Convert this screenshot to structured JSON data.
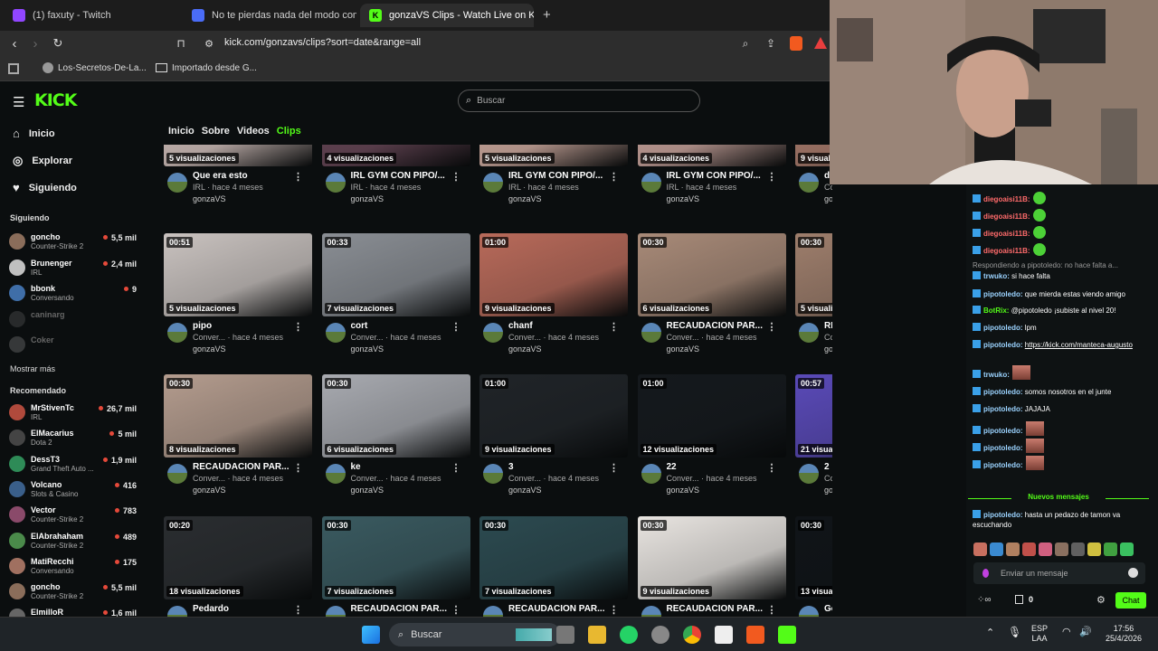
{
  "browser": {
    "tabs": [
      {
        "title": "(1) faxuty - Twitch",
        "favicon_color": "#9146ff"
      },
      {
        "title": "No te pierdas nada del modo compet",
        "favicon_color": "#4a6cf7"
      },
      {
        "title": "gonzaVS Clips - Watch Live on Ki",
        "favicon_color": "#53fc18",
        "favicon_letter": "K"
      }
    ],
    "new_tab": "+",
    "url": "kick.com/gonzavs/clips?sort=date&range=all",
    "bookmarks": [
      {
        "label": "Los-Secretos-De-La..."
      },
      {
        "label": "Importado desde G..."
      }
    ]
  },
  "kick": {
    "logo": "KICK",
    "search_placeholder": "Buscar",
    "nav": [
      {
        "label": "Inicio",
        "icon": "home-icon"
      },
      {
        "label": "Explorar",
        "icon": "compass-icon"
      },
      {
        "label": "Siguiendo",
        "icon": "heart-icon"
      }
    ],
    "following_title": "Siguiendo",
    "following": [
      {
        "name": "goncho",
        "category": "Counter-Strike 2",
        "viewers": "5,5 mil",
        "avatar": "#8a6d5a"
      },
      {
        "name": "Brunenger",
        "category": "IRL",
        "viewers": "2,4 mil",
        "avatar": "#c0c0c0"
      },
      {
        "name": "bbonk",
        "category": "Conversando",
        "viewers": "9",
        "avatar": "#3f6ea8"
      },
      {
        "name": "caninarg",
        "category": "",
        "viewers": "",
        "avatar": "#555555",
        "offline": true
      },
      {
        "name": "Coker",
        "category": "",
        "viewers": "",
        "avatar": "#777777",
        "offline": true
      }
    ],
    "show_more": "Mostrar más",
    "recommended_title": "Recomendado",
    "recommended": [
      {
        "name": "MrStivenTc",
        "category": "IRL",
        "viewers": "26,7 mil",
        "avatar": "#b04a3c"
      },
      {
        "name": "ElMacarius",
        "category": "Dota 2",
        "viewers": "5 mil",
        "avatar": "#444444"
      },
      {
        "name": "DessT3",
        "category": "Grand Theft Auto ...",
        "viewers": "1,9 mil",
        "avatar": "#2e8b57"
      },
      {
        "name": "Volcano",
        "category": "Slots & Casino",
        "viewers": "416",
        "avatar": "#3a5f8a"
      },
      {
        "name": "Vector",
        "category": "Counter-Strike 2",
        "viewers": "783",
        "avatar": "#8a4a6a"
      },
      {
        "name": "ElAbrahaham",
        "category": "Counter-Strike 2",
        "viewers": "489",
        "avatar": "#4a8a4a"
      },
      {
        "name": "MatiRecchi",
        "category": "Conversando",
        "viewers": "175",
        "avatar": "#a07060"
      },
      {
        "name": "goncho",
        "category": "Counter-Strike 2",
        "viewers": "5,5 mil",
        "avatar": "#8a6d5a"
      },
      {
        "name": "ElmilloR",
        "category": "",
        "viewers": "1,6 mil",
        "avatar": "#666666"
      }
    ],
    "channel_tabs": [
      {
        "label": "Inicio",
        "active": false
      },
      {
        "label": "Sobre",
        "active": false
      },
      {
        "label": "Videos",
        "active": false
      },
      {
        "label": "Clips",
        "active": true
      }
    ],
    "clip_rows": [
      [
        {
          "title": "Que era esto",
          "category": "IRL",
          "ago": "hace 4 meses",
          "author": "gonzaVS",
          "views": "5 visualizaciones",
          "duration": "",
          "bg": "#d8c5c0"
        },
        {
          "title": "IRL GYM CON PIPO/...",
          "category": "IRL",
          "ago": "hace 4 meses",
          "author": "gonzaVS",
          "views": "4 visualizaciones",
          "duration": "",
          "bg": "#6a4858"
        },
        {
          "title": "IRL GYM CON PIPO/...",
          "category": "IRL",
          "ago": "hace 4 meses",
          "author": "gonzaVS",
          "views": "5 visualizaciones",
          "duration": "",
          "bg": "#d6b0a4"
        },
        {
          "title": "IRL GYM CON PIPO/...",
          "category": "IRL",
          "ago": "hace 4 meses",
          "author": "gonzaVS",
          "views": "4 visualizaciones",
          "duration": "",
          "bg": "#cfa8a0"
        },
        {
          "title": "dondon",
          "category": "Conver...",
          "ago": "hace 4 meses",
          "author": "gonzaVS",
          "views": "9 visualizaciones",
          "duration": "",
          "bg": "#b08070"
        }
      ],
      [
        {
          "title": "pipo",
          "category": "Conver...",
          "ago": "hace 4 meses",
          "author": "gonzaVS",
          "views": "5 visualizaciones",
          "duration": "00:51",
          "bg": "#c9c2bf"
        },
        {
          "title": "cort",
          "category": "Conver...",
          "ago": "hace 4 meses",
          "author": "gonzaVS",
          "views": "7 visualizaciones",
          "duration": "00:33",
          "bg": "#8a8e94"
        },
        {
          "title": "chanf",
          "category": "Conver...",
          "ago": "hace 4 meses",
          "author": "gonzaVS",
          "views": "9 visualizaciones",
          "duration": "01:00",
          "bg": "#b86a5a"
        },
        {
          "title": "RECAUDACION PAR...",
          "category": "Conver...",
          "ago": "hace 4 meses",
          "author": "gonzaVS",
          "views": "6 visualizaciones",
          "duration": "00:30",
          "bg": "#a88a78"
        },
        {
          "title": "RECAUDACION PAR...",
          "category": "Conver...",
          "ago": "hace 4 meses",
          "author": "gonzaVS",
          "views": "5 visualizaciones",
          "duration": "00:30",
          "bg": "#9e7e6c"
        }
      ],
      [
        {
          "title": "RECAUDACION PAR...",
          "category": "Conver...",
          "ago": "hace 4 meses",
          "author": "gonzaVS",
          "views": "8 visualizaciones",
          "duration": "00:30",
          "bg": "#b49c8e"
        },
        {
          "title": "ke",
          "category": "Conver...",
          "ago": "hace 4 meses",
          "author": "gonzaVS",
          "views": "6 visualizaciones",
          "duration": "00:30",
          "bg": "#a8aab0"
        },
        {
          "title": "3",
          "category": "Conver...",
          "ago": "hace 4 meses",
          "author": "gonzaVS",
          "views": "9 visualizaciones",
          "duration": "01:00",
          "bg": "#202428"
        },
        {
          "title": "22",
          "category": "Conver...",
          "ago": "hace 4 meses",
          "author": "gonzaVS",
          "views": "12 visualizaciones",
          "duration": "01:00",
          "bg": "#15191d"
        },
        {
          "title": "2",
          "category": "Conver...",
          "ago": "hace 4 meses",
          "author": "gonzaVS",
          "views": "21 visualizaciones",
          "duration": "00:57",
          "bg": "#5a4ab8"
        }
      ],
      [
        {
          "title": "Pedardo",
          "category": "",
          "ago": "",
          "author": "",
          "views": "18 visualizaciones",
          "duration": "00:20",
          "bg": "#2a2d30"
        },
        {
          "title": "RECAUDACION PAR...",
          "category": "",
          "ago": "",
          "author": "",
          "views": "7 visualizaciones",
          "duration": "00:30",
          "bg": "#3a5a60"
        },
        {
          "title": "RECAUDACION PAR...",
          "category": "",
          "ago": "",
          "author": "",
          "views": "7 visualizaciones",
          "duration": "00:30",
          "bg": "#2c4a50"
        },
        {
          "title": "RECAUDACION PAR...",
          "category": "",
          "ago": "",
          "author": "",
          "views": "9 visualizaciones",
          "duration": "00:30",
          "bg": "#e8e4e0"
        },
        {
          "title": "God",
          "category": "",
          "ago": "",
          "author": "",
          "views": "13 visualizaciones",
          "duration": "00:30",
          "bg": "#101418"
        }
      ]
    ]
  },
  "chat": {
    "messages": [
      {
        "user": "diegoaisi11B:",
        "text": "",
        "emote": "green",
        "style": "red"
      },
      {
        "user": "diegoaisi11B:",
        "text": "",
        "emote": "green",
        "style": "red"
      },
      {
        "user": "diegoaisi11B:",
        "text": "",
        "emote": "green",
        "style": "red"
      },
      {
        "user": "diegoaisi11B:",
        "text": "",
        "emote": "green",
        "style": "red"
      },
      {
        "user": "",
        "text": "Respondiendo a pipotoledo: no hace falta a...",
        "emote": "",
        "style": "reply"
      },
      {
        "user": "trwuko:",
        "text": "si hace falta",
        "emote": "",
        "style": "blue"
      },
      {
        "user": "pipotoledo:",
        "text": "que mierda estas viendo amigo",
        "emote": "",
        "style": "blue"
      },
      {
        "user": "BotRix:",
        "text": "@pipotoledo ¡subiste al nivel 20!",
        "emote": "",
        "style": "grn"
      },
      {
        "user": "pipotoledo:",
        "text": "lpm",
        "emote": "",
        "style": "blue"
      },
      {
        "user": "pipotoledo:",
        "text": "https://kick.com/manteca-augusto",
        "emote": "",
        "style": "link"
      },
      {
        "user": "trwuko:",
        "text": "",
        "emote": "img",
        "style": "blue"
      },
      {
        "user": "pipotoledo:",
        "text": "somos nosotros en el junte",
        "emote": "",
        "style": "blue"
      },
      {
        "user": "pipotoledo:",
        "text": "JAJAJA",
        "emote": "",
        "style": "blue"
      },
      {
        "user": "pipotoledo:",
        "text": "",
        "emote": "img",
        "style": "blue"
      },
      {
        "user": "pipotoledo:",
        "text": "",
        "emote": "img",
        "style": "blue"
      },
      {
        "user": "pipotoledo:",
        "text": "",
        "emote": "img",
        "style": "blue"
      }
    ],
    "new_messages": "Nuevos mensajes",
    "last_message": {
      "user": "pipotoledo:",
      "text": "hasta un pedazo de tamon va escuchando"
    },
    "input_placeholder": "Enviar un mensaje",
    "counter": "0",
    "send_label": "Chat"
  },
  "taskbar": {
    "search_label": "Buscar",
    "lang": "ESP",
    "lang_sub": "LAA",
    "time": "17:56",
    "date": "25/4/2026"
  }
}
